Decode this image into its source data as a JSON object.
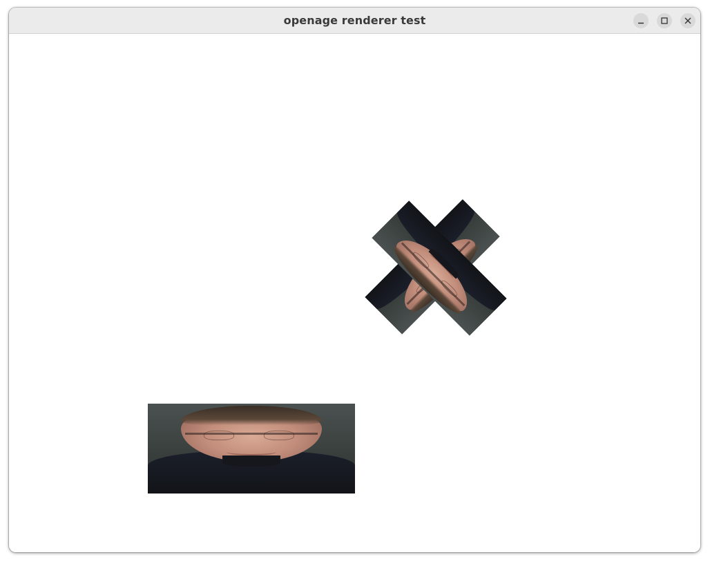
{
  "window": {
    "title": "openage renderer test",
    "controls": {
      "minimize_icon": "minimize-icon",
      "maximize_icon": "maximize-icon",
      "close_icon": "close-icon"
    }
  },
  "canvas": {
    "background": "#ffffff",
    "sprites": [
      {
        "name": "photo-sprite-upright",
        "image": "portrait-photo",
        "rotation_deg": 0
      },
      {
        "name": "photo-sprite-rotated-a",
        "image": "portrait-photo",
        "rotation_deg": 135
      },
      {
        "name": "photo-sprite-rotated-b",
        "image": "portrait-photo",
        "rotation_deg": -135
      }
    ]
  }
}
